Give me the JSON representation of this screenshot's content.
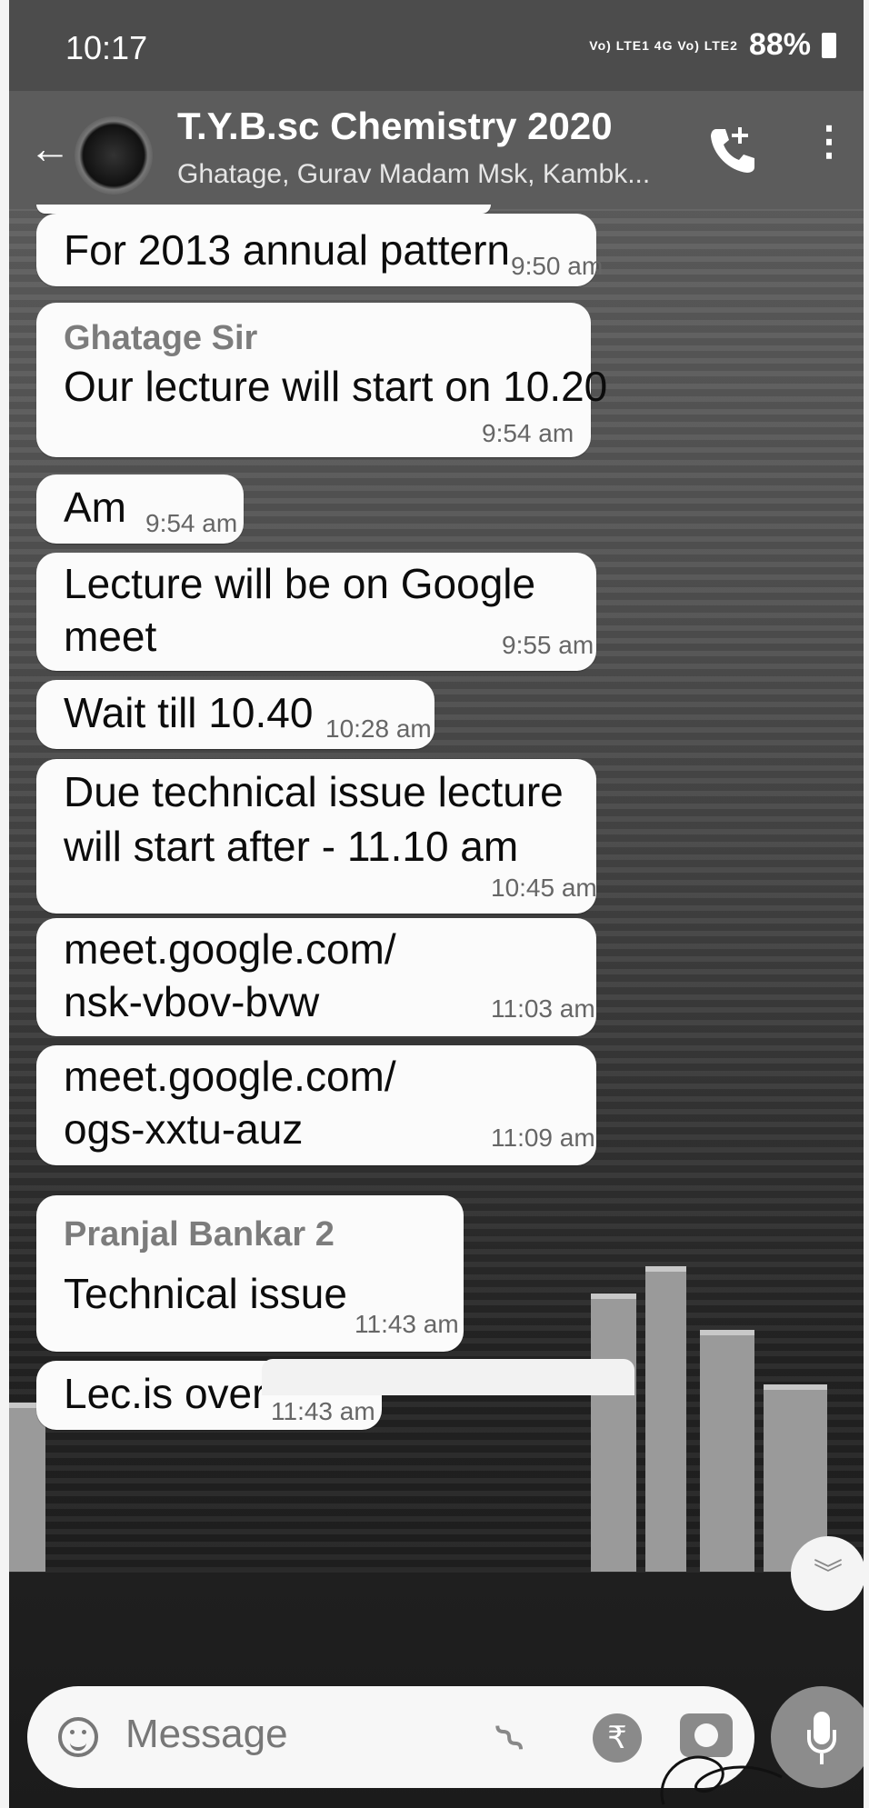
{
  "status_bar": {
    "time": "10:17",
    "network": "Vo) LTE1 4G Vo) LTE2",
    "battery": "88%"
  },
  "toolbar": {
    "title": "T.Y.B.sc Chemistry 2020",
    "subtitle": "Ghatage, Gurav Madam Msk, Kambk..."
  },
  "messages": [
    {
      "text": "For 2013 annual pattern",
      "time": "9:50 am"
    },
    {
      "sender": "Ghatage Sir",
      "text": "Our lecture will start on 10.20",
      "time": "9:54 am"
    },
    {
      "text": "Am",
      "time": "9:54 am"
    },
    {
      "text": "Lecture will be on Google",
      "text2": "meet",
      "time": "9:55 am"
    },
    {
      "text": "Wait till 10.40",
      "time": "10:28 am"
    },
    {
      "text": "Due technical issue lecture",
      "text2": "will start after - 11.10 am",
      "time": "10:45 am"
    },
    {
      "text": "meet.google.com/",
      "text2": "nsk-vbov-bvw",
      "time": "11:03 am"
    },
    {
      "text": "meet.google.com/",
      "text2": "ogs-xxtu-auz",
      "time": "11:09 am"
    },
    {
      "sender": "Pranjal Bankar 2",
      "text": "Technical issue",
      "time": "11:43 am"
    },
    {
      "text": "Lec.is over",
      "time": "11:43 am"
    }
  ],
  "input": {
    "placeholder": "Message",
    "currency_symbol": "₹"
  },
  "icons": {
    "back": "arrow-left-icon",
    "call": "add-call-icon",
    "more": "more-vert-icon",
    "emoji": "emoji-icon",
    "attach": "paperclip-icon",
    "payment": "rupee-icon",
    "camera": "camera-icon",
    "mic": "mic-icon",
    "scroll": "chevron-down-icon"
  }
}
